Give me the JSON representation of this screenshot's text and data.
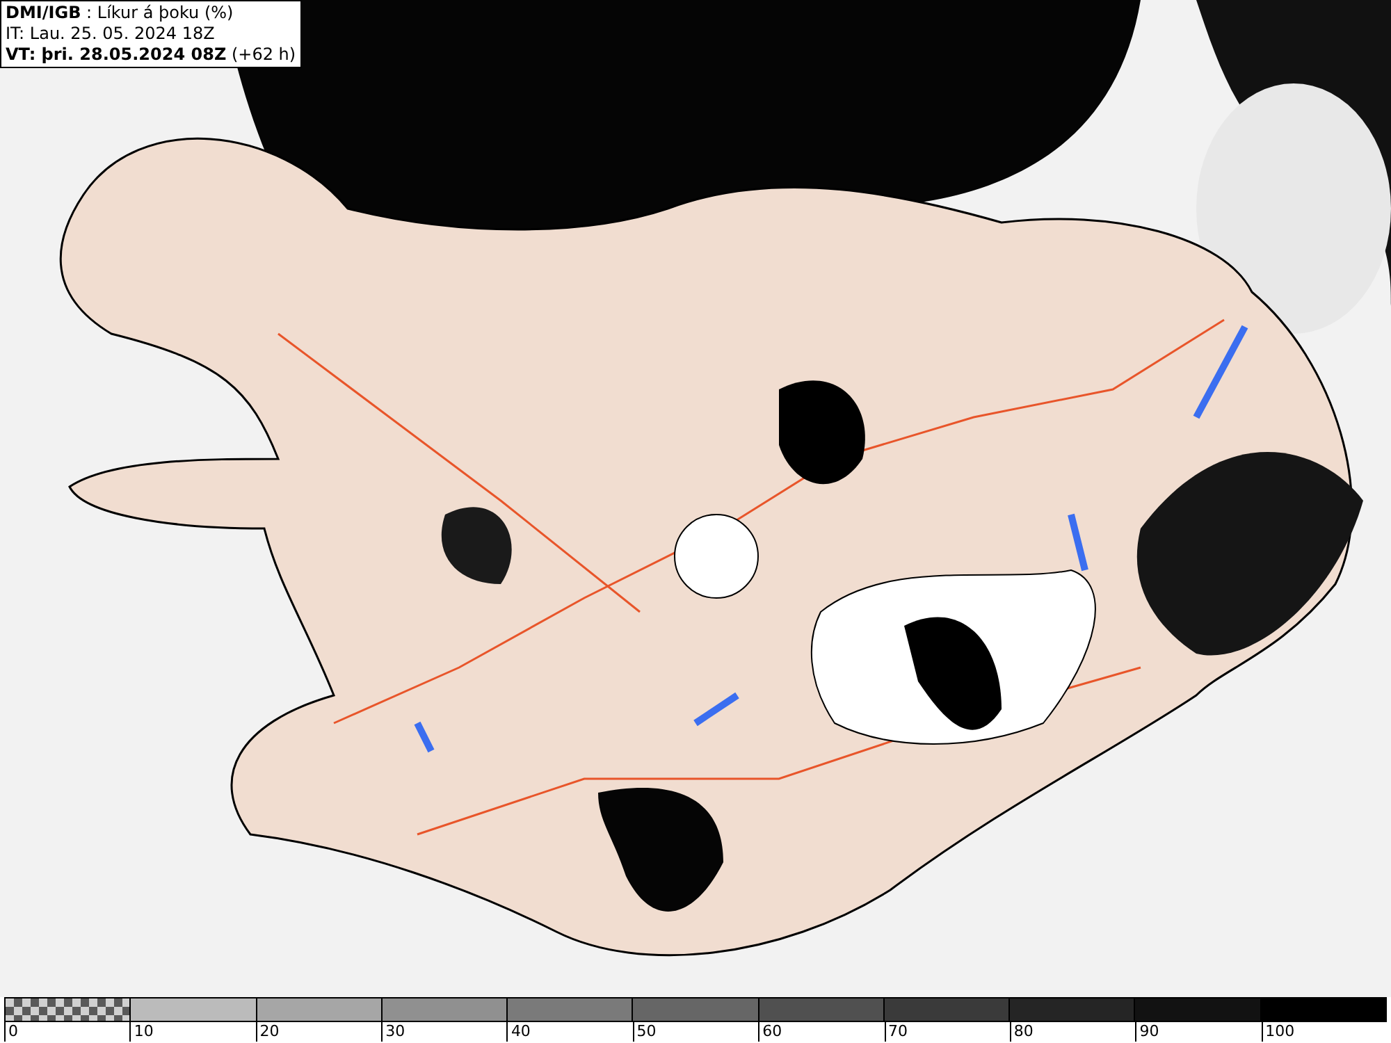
{
  "header": {
    "lines": [
      "**DMI/IGB** : Líkur á þoku (%)",
      "IT: Lau. 25. 05. 2024 18Z",
      "**VT: þri. 28.05.2024 08Z** (+62 h)"
    ]
  },
  "legend": {
    "segments": [
      {
        "kind": "checker",
        "color": "#5a5a5a"
      },
      {
        "kind": "solid",
        "color": "#bbbbbb"
      },
      {
        "kind": "solid",
        "color": "#a6a6a6"
      },
      {
        "kind": "solid",
        "color": "#909090"
      },
      {
        "kind": "solid",
        "color": "#7a7a7a"
      },
      {
        "kind": "solid",
        "color": "#666666"
      },
      {
        "kind": "solid",
        "color": "#505050"
      },
      {
        "kind": "solid",
        "color": "#3a3a3a"
      },
      {
        "kind": "solid",
        "color": "#252525"
      },
      {
        "kind": "solid",
        "color": "#121212"
      },
      {
        "kind": "solid",
        "color": "#000000"
      }
    ],
    "labels": [
      "0",
      "10",
      "20",
      "30",
      "40",
      "50",
      "60",
      "70",
      "80",
      "90",
      "100"
    ]
  }
}
